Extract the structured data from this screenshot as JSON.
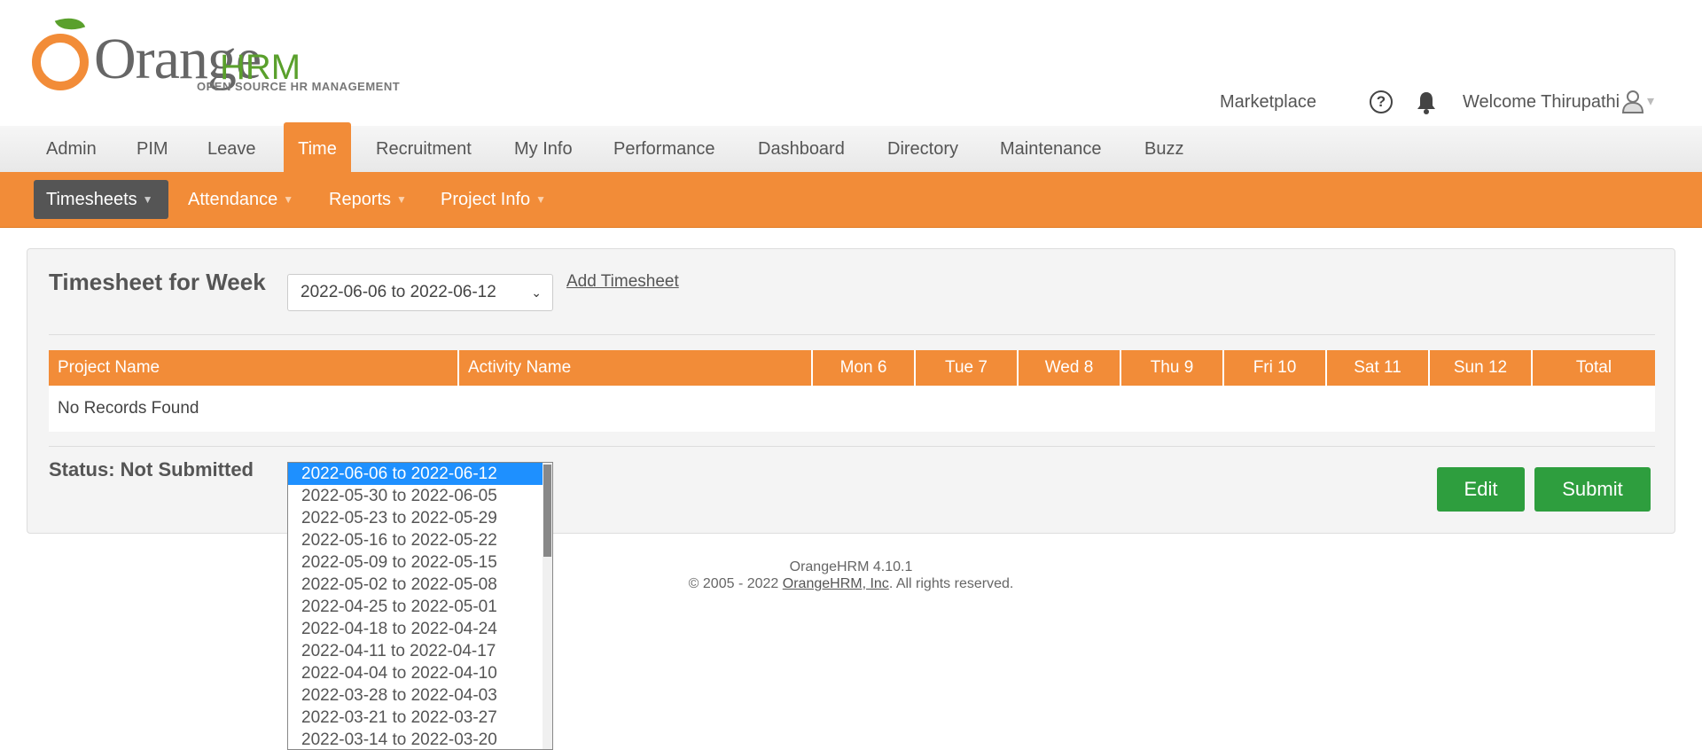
{
  "brand": {
    "logo_text": "Orange",
    "logo_hrm": "HRM",
    "logo_subtitle": "OPEN SOURCE HR MANAGEMENT",
    "accent_color": "#f28c38",
    "leaf_color": "#5aa02c"
  },
  "header": {
    "marketplace": "Marketplace",
    "help_icon": "?",
    "welcome": "Welcome Thirupathi",
    "user_caret": "▾"
  },
  "main_nav": [
    {
      "label": "Admin"
    },
    {
      "label": "PIM"
    },
    {
      "label": "Leave"
    },
    {
      "label": "Time",
      "active": true
    },
    {
      "label": "Recruitment"
    },
    {
      "label": "My Info"
    },
    {
      "label": "Performance"
    },
    {
      "label": "Dashboard"
    },
    {
      "label": "Directory"
    },
    {
      "label": "Maintenance"
    },
    {
      "label": "Buzz"
    }
  ],
  "sub_nav": [
    {
      "label": "Timesheets",
      "active": true
    },
    {
      "label": "Attendance"
    },
    {
      "label": "Reports"
    },
    {
      "label": "Project Info"
    }
  ],
  "timesheet": {
    "title": "Timesheet for Week",
    "selected_week": "2022-06-06 to 2022-06-12",
    "add_link": "Add Timesheet",
    "columns": [
      "Project Name",
      "Activity Name",
      "Mon 6",
      "Tue 7",
      "Wed 8",
      "Thu 9",
      "Fri 10",
      "Sat 11",
      "Sun 12",
      "Total"
    ],
    "empty_message": "No Records Found",
    "status": "Status: Not Submitted",
    "edit_label": "Edit",
    "submit_label": "Submit"
  },
  "footer": {
    "version": "OrangeHRM 4.10.1",
    "copyright_prefix": "© 2005 - 2022 ",
    "company_link": "OrangeHRM, Inc",
    "copyright_suffix": ". All rights reserved."
  },
  "week_options": [
    "2022-06-06 to 2022-06-12",
    "2022-05-30 to 2022-06-05",
    "2022-05-23 to 2022-05-29",
    "2022-05-16 to 2022-05-22",
    "2022-05-09 to 2022-05-15",
    "2022-05-02 to 2022-05-08",
    "2022-04-25 to 2022-05-01",
    "2022-04-18 to 2022-04-24",
    "2022-04-11 to 2022-04-17",
    "2022-04-04 to 2022-04-10",
    "2022-03-28 to 2022-04-03",
    "2022-03-21 to 2022-03-27",
    "2022-03-14 to 2022-03-20"
  ]
}
